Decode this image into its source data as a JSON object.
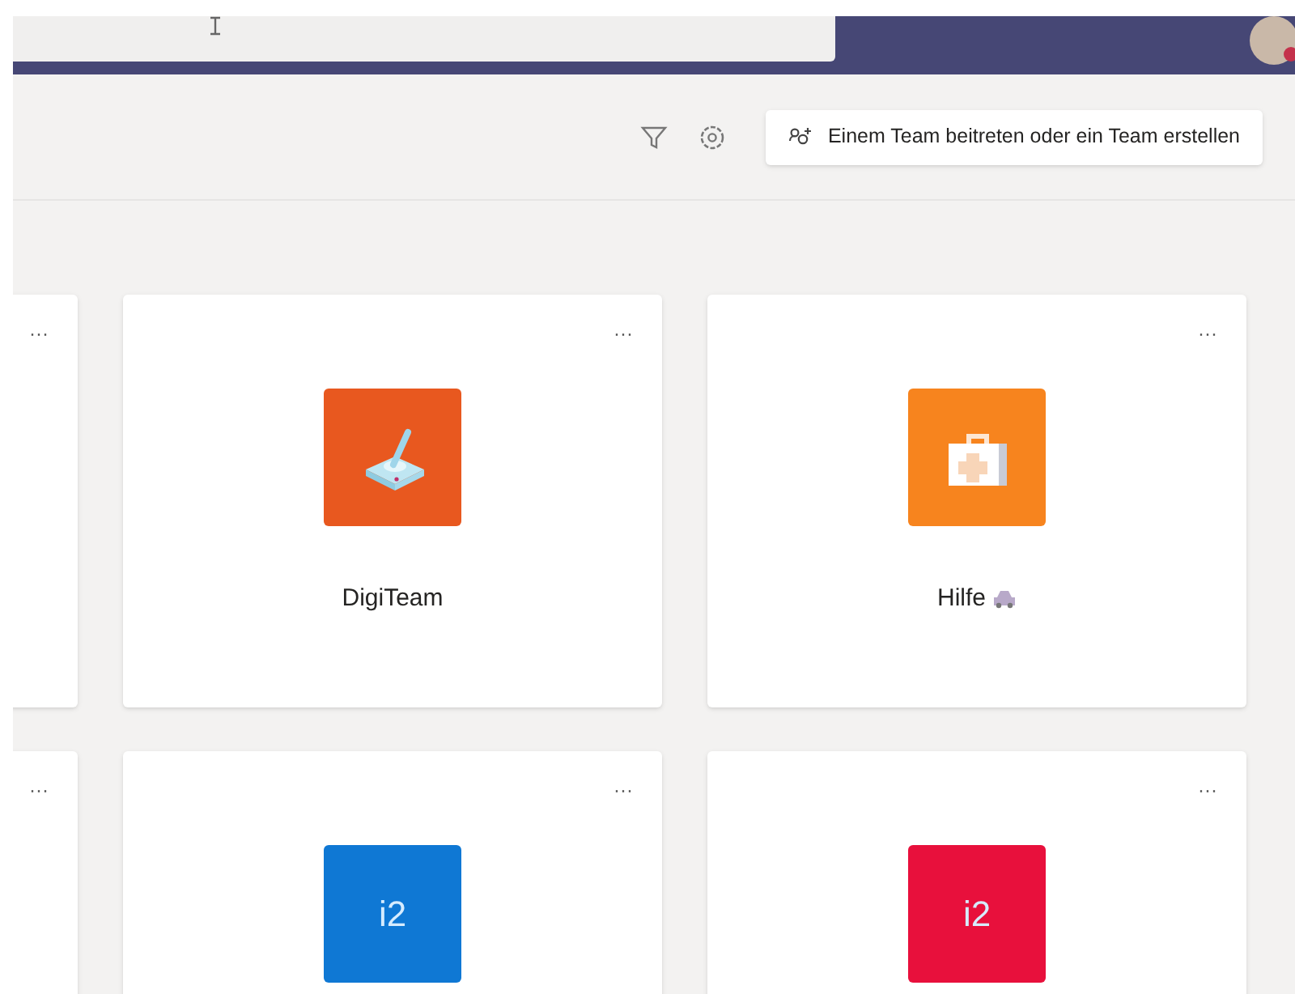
{
  "toolbar": {
    "join_button": "Einem Team beitreten oder ein Team erstellen"
  },
  "teams": [
    {
      "kind": "partial",
      "more": "···"
    },
    {
      "kind": "joystick",
      "name": "DigiTeam",
      "color": "#e8581f",
      "more": "···"
    },
    {
      "kind": "firstaid",
      "name": "Hilfe",
      "color": "#f7841e",
      "more": "···",
      "emoji": true
    },
    {
      "kind": "partial",
      "more": "···"
    },
    {
      "kind": "initials",
      "initials": "i2",
      "color": "#0f78d4",
      "more": "···"
    },
    {
      "kind": "initials",
      "initials": "i2",
      "color": "#e8103c",
      "more": "···"
    }
  ]
}
